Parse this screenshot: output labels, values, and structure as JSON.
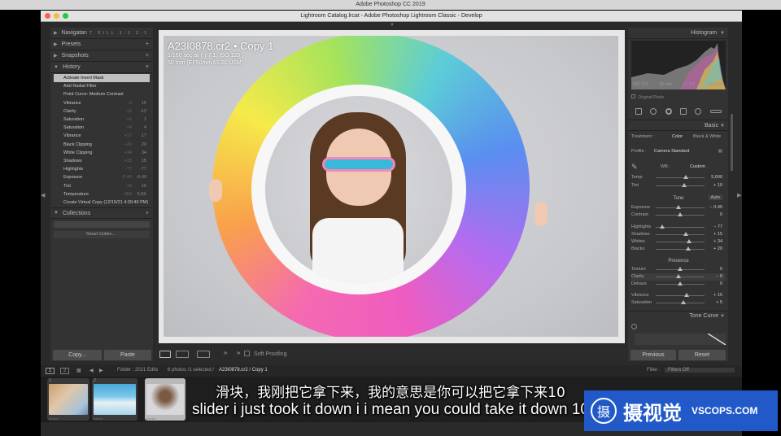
{
  "mac_title": "Adobe Photoshop CC 2019",
  "window_title": "Lightroom Catalog.lrcat - Adobe Photoshop Lightroom Classic - Develop",
  "left_panel": {
    "navigator": {
      "label": "Navigator",
      "zoom_options": [
        "FIT",
        "FILL",
        "1:1",
        "2:1"
      ]
    },
    "presets": {
      "label": "Presets",
      "add": "+"
    },
    "snapshots": {
      "label": "Snapshots",
      "add": "+"
    },
    "history": {
      "label": "History",
      "close": "×",
      "items": [
        {
          "label": "Activate Invert Mask",
          "v1": "",
          "v2": "",
          "active": true
        },
        {
          "label": "Add Radial Filter",
          "v1": "",
          "v2": ""
        },
        {
          "label": "Point Curve: Medium Contrast",
          "v1": "",
          "v2": ""
        },
        {
          "label": "Vibrance",
          "v1": "-5",
          "v2": "15"
        },
        {
          "label": "Clarity",
          "v1": "-12",
          "v2": "-12"
        },
        {
          "label": "Saturation",
          "v1": "+1",
          "v2": "1"
        },
        {
          "label": "Saturation",
          "v1": "+4",
          "v2": "4"
        },
        {
          "label": "Vibrance",
          "v1": "+17",
          "v2": "17"
        },
        {
          "label": "Black Clipping",
          "v1": "+20",
          "v2": "20"
        },
        {
          "label": "White Clipping",
          "v1": "+34",
          "v2": "34"
        },
        {
          "label": "Shadows",
          "v1": "+15",
          "v2": "15"
        },
        {
          "label": "Highlights",
          "v1": "-77",
          "v2": "-77"
        },
        {
          "label": "Exposure",
          "v1": "-0.40",
          "v2": "-0.40"
        },
        {
          "label": "Tint",
          "v1": "+9",
          "v2": "10"
        },
        {
          "label": "Temperature",
          "v1": "-350",
          "v2": "5.6K"
        },
        {
          "label": "Create Virtual Copy (12/15/21 4:30:40 PM)",
          "v1": "",
          "v2": ""
        }
      ]
    },
    "collections": {
      "label": "Collections",
      "add": "+",
      "item": "Smart Collec..."
    }
  },
  "buttons": {
    "copy": "Copy...",
    "paste": "Paste",
    "previous": "Previous",
    "reset": "Reset"
  },
  "photo_info": {
    "title": "A23I0878.cr2  •  Copy 1",
    "line2": "1/160 sec at ƒ / 7.1, ISO 125",
    "line3": "50 mm (EF50mm f/1.2L USM)"
  },
  "toolbar": {
    "soft_proofing": "Soft Proofing",
    "view_labels": [
      "Y|Y"
    ]
  },
  "right_panel": {
    "histogram_label": "Histogram",
    "hist_meta": [
      "ISO 125",
      "50 mm",
      "ƒ / 7.1",
      "1/160 sec"
    ],
    "original_photo": "Original Photo",
    "basic_label": "Basic",
    "treatment": {
      "label": "Treatment :",
      "color": "Color",
      "bw": "Black & White"
    },
    "profile": {
      "label": "Profile :",
      "value": "Camera Standard"
    },
    "wb": {
      "label": "WB :",
      "value": "Custom"
    },
    "temp": {
      "label": "Temp",
      "value": "5,600"
    },
    "tint": {
      "label": "Tint",
      "value": "+ 10"
    },
    "tone_label": "Tone",
    "auto": "Auto",
    "exposure": {
      "label": "Exposure",
      "value": "− 0.40"
    },
    "contrast": {
      "label": "Contrast",
      "value": "0"
    },
    "highlights": {
      "label": "Highlights",
      "value": "− 77"
    },
    "shadows": {
      "label": "Shadows",
      "value": "+ 15"
    },
    "whites": {
      "label": "Whites",
      "value": "+ 34"
    },
    "blacks": {
      "label": "Blacks",
      "value": "+ 20"
    },
    "presence_label": "Presence",
    "texture": {
      "label": "Texture",
      "value": "0"
    },
    "clarity": {
      "label": "Clarity",
      "value": "− 9"
    },
    "dehaze": {
      "label": "Dehaze",
      "value": "0"
    },
    "vibrance": {
      "label": "Vibrance",
      "value": "+ 15"
    },
    "saturation": {
      "label": "Saturation",
      "value": "+ 5"
    },
    "tone_curve_label": "Tone Curve"
  },
  "filmbar": {
    "page1": "1",
    "page2": "2",
    "folder": "Folder : 2021 Edits",
    "count": "6 photos /1 selected /",
    "filename": "A23I0878.cr2 / Copy 1",
    "filter_label": "Filter :",
    "filter_value": "Filters Off"
  },
  "thumbs": [
    {
      "num": "1",
      "stars": "•••••"
    },
    {
      "num": "2",
      "stars": "•••••"
    },
    {
      "num": "",
      "stars": "•••••"
    }
  ],
  "subtitles": {
    "zh": "滑块，我刚把它拿下来，我的意思是你可以把它拿下来10",
    "en": "slider i just took it down i i mean you could take it down 10"
  },
  "watermark": {
    "glyph": "摄",
    "text": "摄视觉",
    "url": "VSCOPS.COM"
  },
  "colors": {
    "accent_blue": "#2259c9",
    "panel": "#333333",
    "active_history": "#bfbfbf"
  }
}
